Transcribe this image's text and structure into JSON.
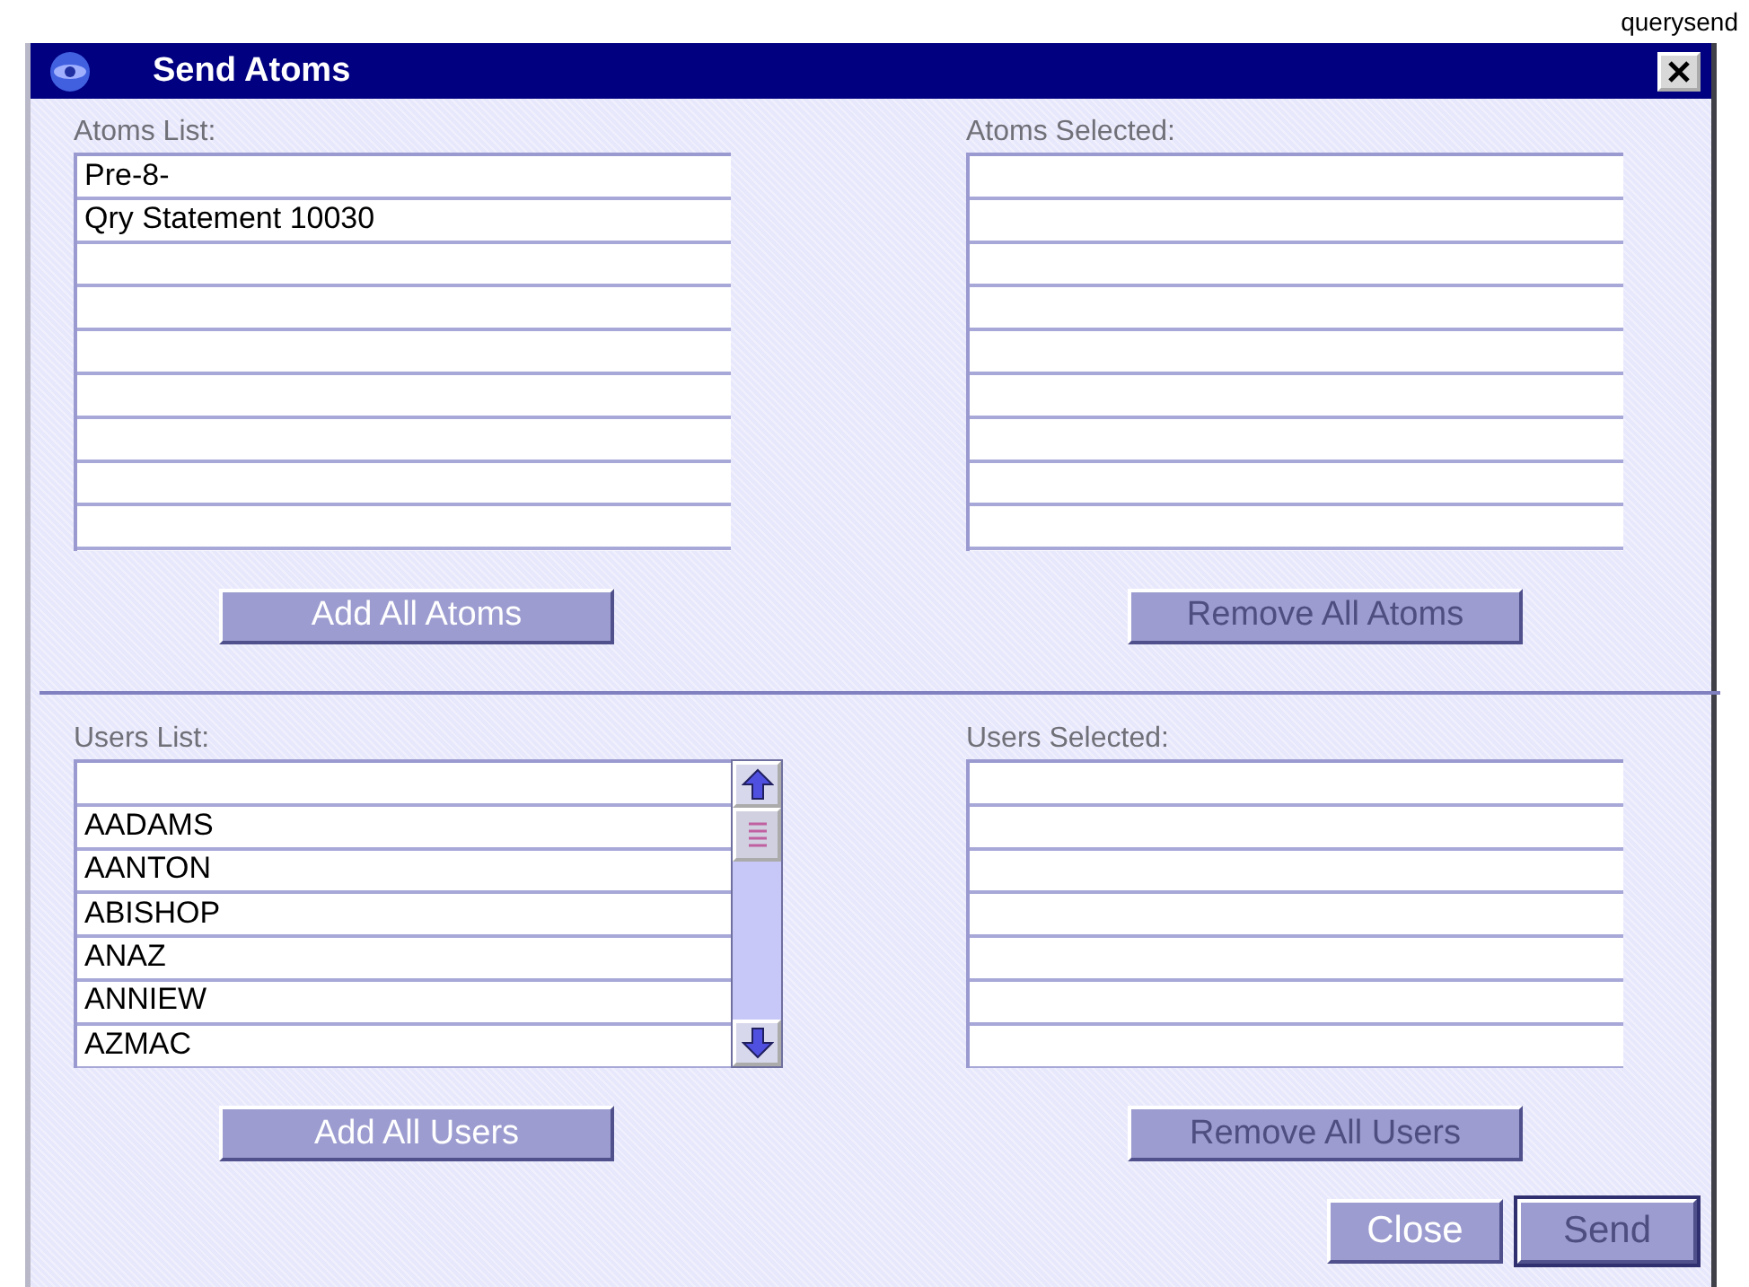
{
  "caption": "querysend",
  "window": {
    "title": "Send Atoms"
  },
  "sections": [
    {
      "lists": [
        {
          "label": "Atoms List:",
          "kind": "plain",
          "items": [
            "Pre-8-",
            "Qry Statement 10030"
          ]
        },
        {
          "label": "Atoms Selected:",
          "kind": "plain"
        }
      ],
      "buttons": [
        {
          "label": "Add All Atoms",
          "disabled": false
        },
        {
          "label": "Remove All Atoms",
          "disabled": true
        }
      ]
    },
    {
      "lists": [
        {
          "label": "Users List:",
          "kind": "scrolling",
          "items": [
            "AADAMS",
            "AANTON",
            "ABISHOP",
            "ANAZ",
            "ANNIEW",
            "AZMAC"
          ]
        },
        {
          "label": "Users Selected:",
          "kind": "plain"
        }
      ],
      "buttons": [
        {
          "label": "Add All Users",
          "disabled": false
        },
        {
          "label": "Remove All Users",
          "disabled": true
        }
      ]
    }
  ],
  "footer_buttons": [
    {
      "label": "Close",
      "disabled": false,
      "default": false
    },
    {
      "label": "Send",
      "disabled": true,
      "default": true
    }
  ]
}
